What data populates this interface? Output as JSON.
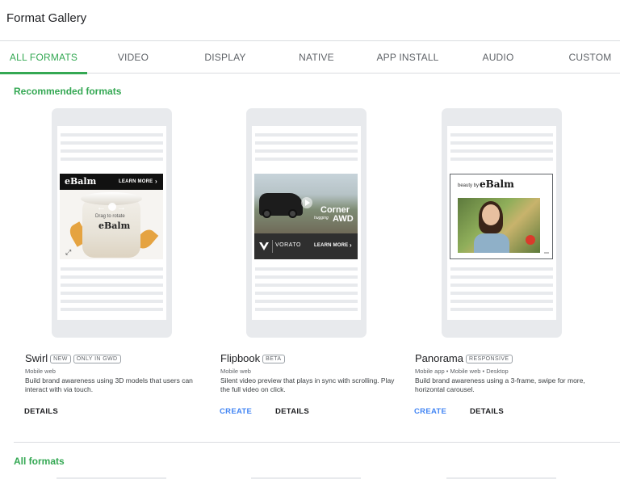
{
  "header": {
    "title": "Format Gallery"
  },
  "tabs": [
    {
      "label": "ALL FORMATS",
      "active": true
    },
    {
      "label": "VIDEO",
      "active": false
    },
    {
      "label": "DISPLAY",
      "active": false
    },
    {
      "label": "NATIVE",
      "active": false
    },
    {
      "label": "APP INSTALL",
      "active": false
    },
    {
      "label": "AUDIO",
      "active": false
    },
    {
      "label": "CUSTOM",
      "active": false
    }
  ],
  "sections": {
    "recommended": "Recommended formats",
    "all": "All formats"
  },
  "creatives": {
    "swirl": {
      "brand": "eBalm",
      "cta": "LEARN MORE",
      "drag_text": "Drag to rotate",
      "jar_brand": "eBalm"
    },
    "flipbook": {
      "headline": "Corner",
      "subline": "hugging",
      "headline2": "AWD",
      "brand": "VORATO",
      "cta": "LEARN MORE"
    },
    "panorama": {
      "prefix": "beauty by",
      "brand": "eBalm"
    }
  },
  "formats": [
    {
      "name": "Swirl",
      "badges": [
        "NEW",
        "ONLY IN GWD"
      ],
      "platform": "Mobile web",
      "description": "Build brand awareness using 3D models that users can interact with via touch.",
      "actions": [
        "DETAILS"
      ]
    },
    {
      "name": "Flipbook",
      "badges": [
        "BETA"
      ],
      "platform": "Mobile web",
      "description": "Silent video preview that plays in sync with scrolling. Play the full video on click.",
      "actions": [
        "CREATE",
        "DETAILS"
      ]
    },
    {
      "name": "Panorama",
      "badges": [
        "RESPONSIVE"
      ],
      "platform": "Mobile app • Mobile web • Desktop",
      "description": "Build brand awareness using a 3-frame, swipe for more, horizontal carousel.",
      "actions": [
        "CREATE",
        "DETAILS"
      ]
    }
  ],
  "colors": {
    "accent_green": "#34a853",
    "link_blue": "#4285f4",
    "phone_frame": "#e8eaed"
  }
}
